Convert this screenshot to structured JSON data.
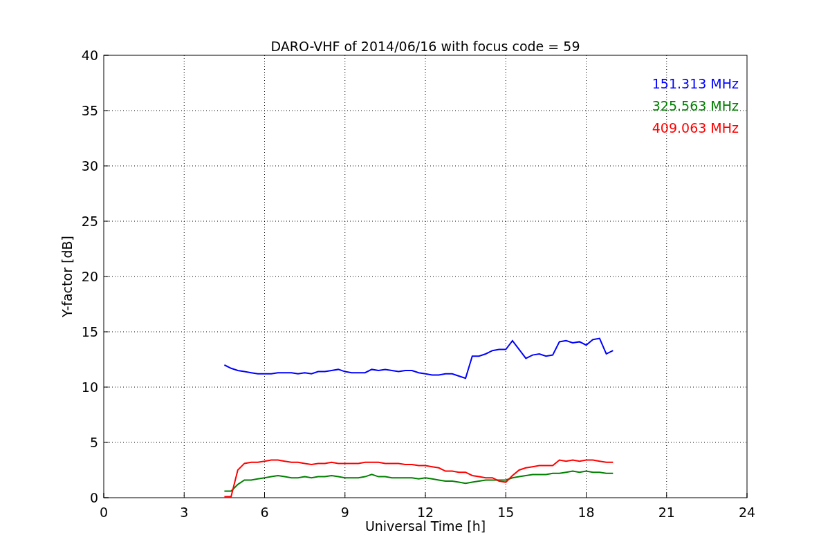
{
  "chart_data": {
    "type": "line",
    "title": "DARO-VHF of 2014/06/16 with focus code = 59",
    "xlabel": "Universal Time [h]",
    "ylabel": "Y-factor [dB]",
    "x": [
      4.5,
      4.75,
      5,
      5.25,
      5.5,
      5.75,
      6,
      6.25,
      6.5,
      6.75,
      7,
      7.25,
      7.5,
      7.75,
      8,
      8.25,
      8.5,
      8.75,
      9,
      9.25,
      9.5,
      9.75,
      10,
      10.25,
      10.5,
      10.75,
      11,
      11.25,
      11.5,
      11.75,
      12,
      12.25,
      12.5,
      12.75,
      13,
      13.25,
      13.5,
      13.75,
      14,
      14.25,
      14.5,
      14.75,
      15,
      15.25,
      15.5,
      15.75,
      16,
      16.25,
      16.5,
      16.75,
      17,
      17.25,
      17.5,
      17.75,
      18,
      18.25,
      18.5,
      18.75,
      19
    ],
    "series": [
      {
        "name": "151.313 MHz",
        "color": "#0000ff",
        "values": [
          12,
          11.7,
          11.5,
          11.4,
          11.3,
          11.2,
          11.2,
          11.2,
          11.3,
          11.3,
          11.3,
          11.2,
          11.3,
          11.2,
          11.4,
          11.4,
          11.5,
          11.6,
          11.4,
          11.3,
          11.3,
          11.3,
          11.6,
          11.5,
          11.6,
          11.5,
          11.4,
          11.5,
          11.5,
          11.3,
          11.2,
          11.1,
          11.1,
          11.2,
          11.2,
          11,
          10.8,
          12.8,
          12.8,
          13,
          13.3,
          13.4,
          13.4,
          14.2,
          13.4,
          12.6,
          12.9,
          13,
          12.8,
          12.9,
          14.1,
          14.2,
          14,
          14.1,
          13.8,
          14.3,
          14.4,
          13,
          13.3
        ]
      },
      {
        "name": "325.563 MHz",
        "color": "#008000",
        "values": [
          0.6,
          0.6,
          1.2,
          1.6,
          1.6,
          1.7,
          1.8,
          1.9,
          2,
          1.9,
          1.8,
          1.8,
          1.9,
          1.8,
          1.9,
          1.9,
          2,
          1.9,
          1.8,
          1.8,
          1.8,
          1.9,
          2.1,
          1.9,
          1.9,
          1.8,
          1.8,
          1.8,
          1.8,
          1.7,
          1.8,
          1.7,
          1.6,
          1.5,
          1.5,
          1.4,
          1.3,
          1.4,
          1.5,
          1.6,
          1.6,
          1.6,
          1.6,
          1.8,
          1.9,
          2,
          2.1,
          2.1,
          2.1,
          2.2,
          2.2,
          2.3,
          2.4,
          2.3,
          2.4,
          2.3,
          2.3,
          2.2,
          2.2
        ]
      },
      {
        "name": "409.063 MHz",
        "color": "#ff0000",
        "values": [
          0.1,
          0.1,
          2.5,
          3.1,
          3.2,
          3.2,
          3.3,
          3.4,
          3.4,
          3.3,
          3.2,
          3.2,
          3.1,
          3,
          3.1,
          3.1,
          3.2,
          3.1,
          3.1,
          3.1,
          3.1,
          3.2,
          3.2,
          3.2,
          3.1,
          3.1,
          3.1,
          3,
          3,
          2.9,
          2.9,
          2.8,
          2.7,
          2.4,
          2.4,
          2.3,
          2.3,
          2,
          1.9,
          1.8,
          1.8,
          1.5,
          1.4,
          2,
          2.5,
          2.7,
          2.8,
          2.9,
          2.9,
          2.9,
          3.4,
          3.3,
          3.4,
          3.3,
          3.4,
          3.4,
          3.3,
          3.2,
          3.2
        ]
      }
    ],
    "grid": true,
    "xlim": [
      0,
      24
    ],
    "ylim": [
      0,
      40
    ],
    "xticks": [
      0,
      3,
      6,
      9,
      12,
      15,
      18,
      21,
      24
    ],
    "yticks": [
      0,
      5,
      10,
      15,
      20,
      25,
      30,
      35,
      40
    ]
  }
}
